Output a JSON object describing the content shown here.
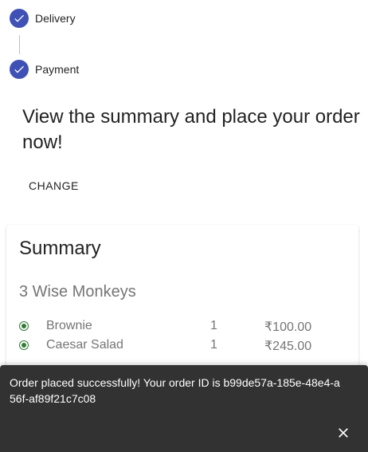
{
  "stepper": {
    "steps": [
      {
        "label": "Delivery",
        "icon": "check-icon"
      },
      {
        "label": "Payment",
        "icon": "check-icon"
      }
    ],
    "active_color": "#3f51b5",
    "content_title": "View the summary and place your order now!",
    "change_label": "CHANGE"
  },
  "summary": {
    "title": "Summary",
    "restaurant": "3 Wise Monkeys",
    "items": [
      {
        "name": "Brownie",
        "qty": "1",
        "price": "₹100.00",
        "icon": "veg-icon"
      },
      {
        "name": "Caesar Salad",
        "qty": "1",
        "price": "₹245.00",
        "icon": "veg-icon"
      }
    ]
  },
  "snackbar": {
    "message": "Order placed successfully! Your order ID is b99de57a-185e-48e4-a56f-af89f21c7c08",
    "close_icon": "close-icon"
  }
}
